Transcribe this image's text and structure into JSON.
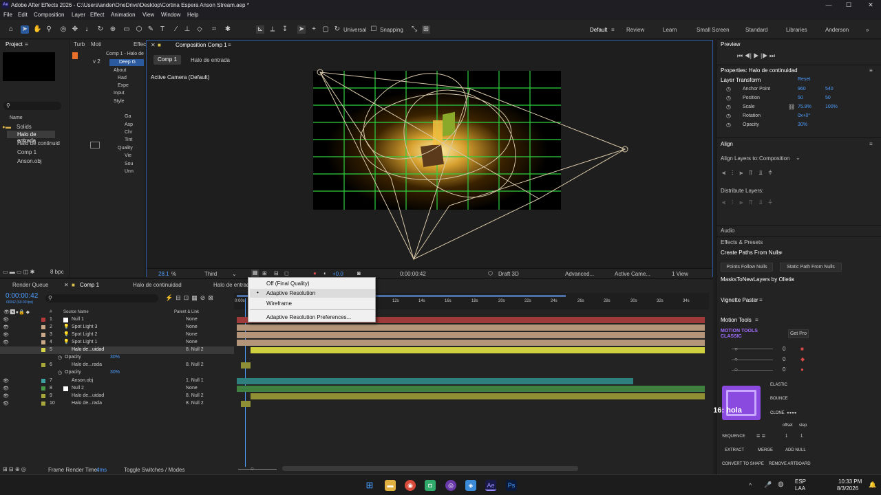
{
  "window": {
    "title": "Adobe After Effects 2026 - C:\\Users\\ander\\OneDrive\\Desktop\\Cortina Espera Anson Stream.aep *",
    "app_badge": "Ae",
    "min": "—",
    "max": "☐",
    "close": "✕"
  },
  "menu": [
    "File",
    "Edit",
    "Composition",
    "Layer",
    "Effect",
    "Animation",
    "View",
    "Window",
    "Help"
  ],
  "toolbar": {
    "universal": "Universal",
    "snapping": "Snapping"
  },
  "workspaces": [
    "Default",
    "Review",
    "Learn",
    "Small Screen",
    "Standard",
    "Libraries",
    "Anderson"
  ],
  "project": {
    "tabs": [
      "Project",
      "Turb",
      "Moti",
      "Effec"
    ],
    "search_placeholder": "",
    "col_name": "Name",
    "items": [
      "Solids",
      "Halo de entrada",
      "Halo de continuid",
      "Comp 1",
      "Anson.obj"
    ],
    "bpc": "8 bpc",
    "v2": "v 2"
  },
  "effects": {
    "header": "Comp 1 - Halo de",
    "items": [
      "Deep G",
      "About",
      "Rad",
      "Expe",
      "Input",
      "Style",
      "Ga",
      "Asp",
      "Chr",
      "Tint",
      "Quality",
      "Vie",
      "Sou",
      "Unn"
    ]
  },
  "comp": {
    "tab": "Composition Comp 1",
    "crumbs": [
      "Comp 1",
      "Halo de entrada"
    ],
    "camera": "Active Camera (Default)",
    "zoom": "28.1",
    "zoom_unit": "%",
    "res": "Third",
    "offset": "+0.0",
    "time": "0:00:00:42",
    "renderer": "Draft 3D",
    "adv": "Advanced...",
    "cam": "Active Came...",
    "view": "1 View"
  },
  "context_menu": {
    "items": [
      "Off (Final Quality)",
      "Adaptive Resolution",
      "Wireframe",
      "Adaptive Resolution Preferences..."
    ],
    "selected_bullet": "•"
  },
  "timeline": {
    "tabs": [
      "Render Queue",
      "Comp 1",
      "Halo de continuidad",
      "Halo de entrada"
    ],
    "time": "0:00:00:42",
    "fps": "00042 (60.00 fps)",
    "col_num": "#",
    "col_source": "Source Name",
    "col_parent": "Parent & Link",
    "ruler": [
      "0:00s",
      "12s",
      "14s",
      "16s",
      "18s",
      "20s",
      "22s",
      "24s",
      "26s",
      "28s",
      "30s",
      "32s",
      "34s"
    ],
    "layers": [
      {
        "n": "1",
        "name": "Null 1",
        "parent": "None",
        "color": "#b23a3a"
      },
      {
        "n": "2",
        "name": "Spot Light 3",
        "parent": "None",
        "color": "#c9a98a"
      },
      {
        "n": "3",
        "name": "Spot Light 2",
        "parent": "None",
        "color": "#c9a98a"
      },
      {
        "n": "4",
        "name": "Spot Light 1",
        "parent": "None",
        "color": "#c9a98a"
      },
      {
        "n": "5",
        "name": "Halo de...uidad",
        "parent": "8. Null 2",
        "color": "#d4d44a"
      },
      {
        "n": "",
        "name": "Opacity",
        "parent": "30%",
        "color": ""
      },
      {
        "n": "6",
        "name": "Halo de...rada",
        "parent": "8. Null 2",
        "color": "#a8a83a"
      },
      {
        "n": "",
        "name": "Opacity",
        "parent": "30%",
        "color": ""
      },
      {
        "n": "7",
        "name": "Anson.obj",
        "parent": "1. Null 1",
        "color": "#3aa0a0"
      },
      {
        "n": "8",
        "name": "Null 2",
        "parent": "None",
        "color": "#4a9a4a"
      },
      {
        "n": "9",
        "name": "Halo de...uidad",
        "parent": "8. Null 2",
        "color": "#a8a83a"
      },
      {
        "n": "10",
        "name": "Halo de...rada",
        "parent": "8. Null 2",
        "color": "#a8a83a"
      }
    ],
    "frame_render": "Frame Render Time:",
    "frame_render_val": "4ms",
    "toggle": "Toggle Switches / Modes"
  },
  "preview": {
    "title": "Preview"
  },
  "properties": {
    "title": "Properties: Halo de continuidad",
    "section": "Layer Transform",
    "reset": "Reset",
    "rows": [
      {
        "label": "Anchor Point",
        "v1": "960",
        "v2": "540"
      },
      {
        "label": "Position",
        "v1": "50",
        "v2": "50"
      },
      {
        "label": "Scale",
        "v1": "75.8%",
        "v2": "100%"
      },
      {
        "label": "Rotation",
        "v1": "0x+0°",
        "v2": ""
      },
      {
        "label": "Opacity",
        "v1": "30%",
        "v2": ""
      }
    ]
  },
  "align": {
    "title": "Align",
    "align_to_label": "Align Layers to:",
    "align_to": "Composition",
    "distribute": "Distribute Layers:"
  },
  "panels": {
    "audio": "Audio",
    "effects_presets": "Effects & Presets",
    "paths": "Create Paths From Nulls",
    "pfn": "Points Follow Nulls",
    "sfn": "Static Path From Nulls",
    "masks": "MasksToNewLayers by Olletix",
    "vignette": "Vignette Paster",
    "motion": "Motion Tools"
  },
  "motion_tools": {
    "logo1": "MOTION TOOLS",
    "logo2": "CLASSIC",
    "getpro": "Get Pro",
    "vals": [
      "0",
      "0",
      "0"
    ],
    "elastic": "ELASTIC",
    "bounce": "BOUNCE",
    "clone": "CLONE",
    "offset": "offset",
    "step": "step",
    "sequence": "SEQUENCE",
    "seq_v1": "1",
    "seq_v2": "1",
    "extract": "EXTRACT",
    "merge": "MERGE",
    "add_null": "ADD NULL",
    "convert": "CONVERT TO SHAPE",
    "remove": "REMOVE ARTBOARD"
  },
  "overlay": {
    "chat": "Anson16: hola"
  },
  "taskbar": {
    "lang1": "ESP",
    "lang2": "LAA",
    "time": "10:33 PM",
    "date": "8/3/2026"
  }
}
